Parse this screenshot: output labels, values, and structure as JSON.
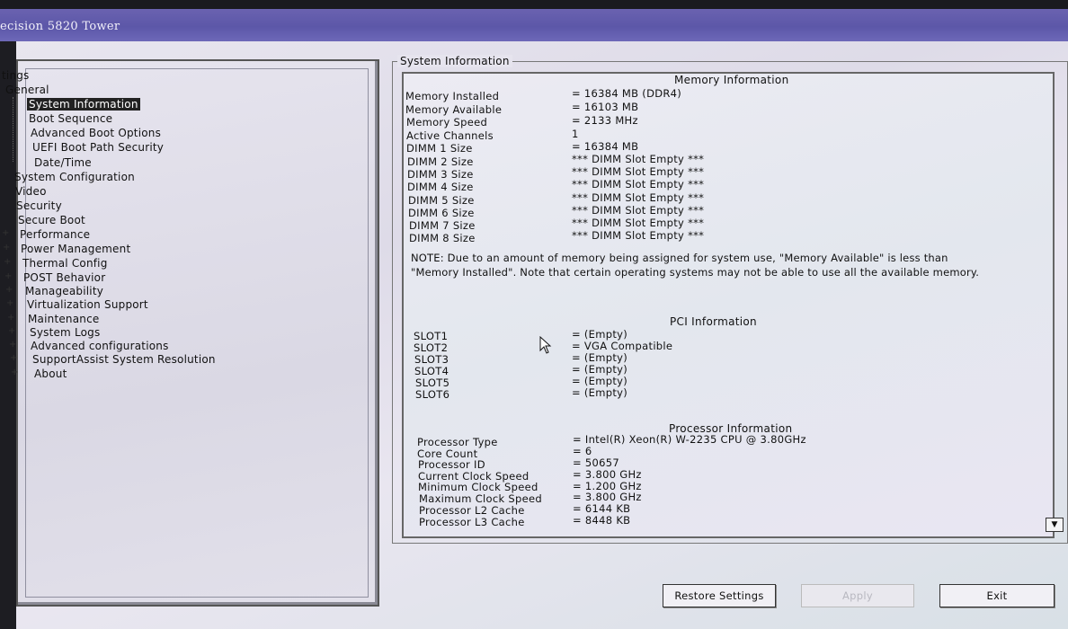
{
  "window": {
    "title": "ecision 5820 Tower"
  },
  "tree": {
    "root_label": "tings",
    "general": {
      "label": "General",
      "children": [
        {
          "label": "System Information"
        },
        {
          "label": "Boot Sequence"
        },
        {
          "label": "Advanced Boot Options"
        },
        {
          "label": "UEFI Boot Path Security"
        },
        {
          "label": "Date/Time"
        }
      ]
    },
    "items": [
      {
        "label": "System Configuration"
      },
      {
        "label": "Video"
      },
      {
        "label": "Security"
      },
      {
        "label": "Secure Boot"
      },
      {
        "label": "Performance"
      },
      {
        "label": "Power Management"
      },
      {
        "label": "Thermal Config"
      },
      {
        "label": "POST Behavior"
      },
      {
        "label": "Manageability"
      },
      {
        "label": "Virtualization Support"
      },
      {
        "label": "Maintenance"
      },
      {
        "label": "System Logs"
      },
      {
        "label": "Advanced configurations"
      },
      {
        "label": "SupportAssist System Resolution"
      },
      {
        "label": "About"
      }
    ]
  },
  "panel": {
    "group_title": "System Information",
    "memory": {
      "title": "Memory Information",
      "rows": [
        {
          "label": "Memory Installed",
          "value": "= 16384 MB (DDR4)"
        },
        {
          "label": "Memory Available",
          "value": "= 16103 MB"
        },
        {
          "label": "Memory Speed",
          "value": "= 2133 MHz"
        },
        {
          "label": "Active Channels",
          "value": "1"
        },
        {
          "label": "DIMM 1 Size",
          "value": "= 16384 MB"
        },
        {
          "label": "DIMM 2 Size",
          "value": "*** DIMM Slot Empty ***"
        },
        {
          "label": "DIMM 3 Size",
          "value": "*** DIMM Slot Empty ***"
        },
        {
          "label": "DIMM 4 Size",
          "value": "*** DIMM Slot Empty ***"
        },
        {
          "label": "DIMM 5 Size",
          "value": "*** DIMM Slot Empty ***"
        },
        {
          "label": "DIMM 6 Size",
          "value": "*** DIMM Slot Empty ***"
        },
        {
          "label": "DIMM 7 Size",
          "value": "*** DIMM Slot Empty ***"
        },
        {
          "label": "DIMM 8 Size",
          "value": "*** DIMM Slot Empty ***"
        }
      ],
      "note": "NOTE: Due to an amount of memory being assigned for system use, \"Memory Available\" is less than \"Memory Installed\". Note that certain operating systems may not be able to use all the available memory."
    },
    "pci": {
      "title": "PCI Information",
      "rows": [
        {
          "label": "SLOT1",
          "value": "= (Empty)"
        },
        {
          "label": "SLOT2",
          "value": "= VGA Compatible"
        },
        {
          "label": "SLOT3",
          "value": "= (Empty)"
        },
        {
          "label": "SLOT4",
          "value": "= (Empty)"
        },
        {
          "label": "SLOT5",
          "value": "= (Empty)"
        },
        {
          "label": "SLOT6",
          "value": "= (Empty)"
        }
      ]
    },
    "processor": {
      "title": "Processor Information",
      "rows": [
        {
          "label": "Processor Type",
          "value": "= Intel(R) Xeon(R) W-2235 CPU @ 3.80GHz"
        },
        {
          "label": "Core Count",
          "value": "= 6"
        },
        {
          "label": "Processor ID",
          "value": "= 50657"
        },
        {
          "label": "Current Clock Speed",
          "value": "= 3.800 GHz"
        },
        {
          "label": "Minimum Clock Speed",
          "value": "= 1.200 GHz"
        },
        {
          "label": "Maximum Clock Speed",
          "value": "= 3.800 GHz"
        },
        {
          "label": "Processor L2 Cache",
          "value": "= 6144 KB"
        },
        {
          "label": "Processor L3 Cache",
          "value": "= 8448 KB"
        }
      ]
    }
  },
  "buttons": {
    "restore": "Restore Settings",
    "apply": "Apply",
    "exit": "Exit"
  }
}
